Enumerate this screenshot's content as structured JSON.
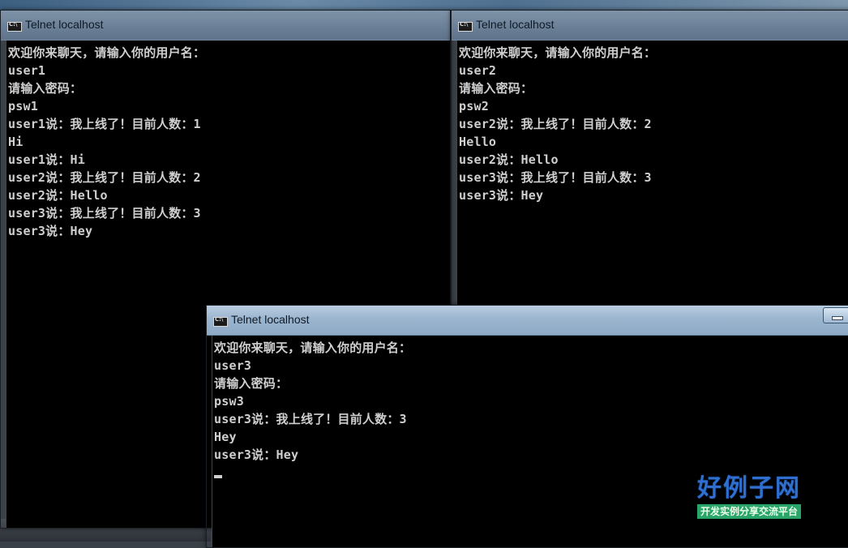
{
  "windows": [
    {
      "title": "Telnet localhost",
      "lines": [
        "欢迎你来聊天，请输入你的用户名：",
        "user1",
        "请输入密码：",
        "psw1",
        "user1说：我上线了！目前人数：1",
        "Hi",
        "user1说：Hi",
        "user2说：我上线了！目前人数：2",
        "user2说：Hello",
        "user3说：我上线了！目前人数：3",
        "user3说：Hey"
      ]
    },
    {
      "title": "Telnet localhost",
      "lines": [
        "欢迎你来聊天，请输入你的用户名：",
        "user2",
        "请输入密码：",
        "psw2",
        "user2说：我上线了！目前人数：2",
        "Hello",
        "user2说：Hello",
        "user3说：我上线了！目前人数：3",
        "user3说：Hey"
      ]
    },
    {
      "title": "Telnet localhost",
      "lines": [
        "欢迎你来聊天，请输入你的用户名：",
        "user3",
        "请输入密码：",
        "psw3",
        "user3说：我上线了！目前人数：3",
        "Hey",
        "user3说：Hey"
      ]
    }
  ],
  "watermark": {
    "brand": "好例子网",
    "tagline": "开发实例分享交流平台"
  },
  "colors": {
    "console_bg": "#000000",
    "console_text": "#cfcfcf",
    "watermark_blue": "#2f6fd0",
    "watermark_green": "#2aa56a"
  }
}
